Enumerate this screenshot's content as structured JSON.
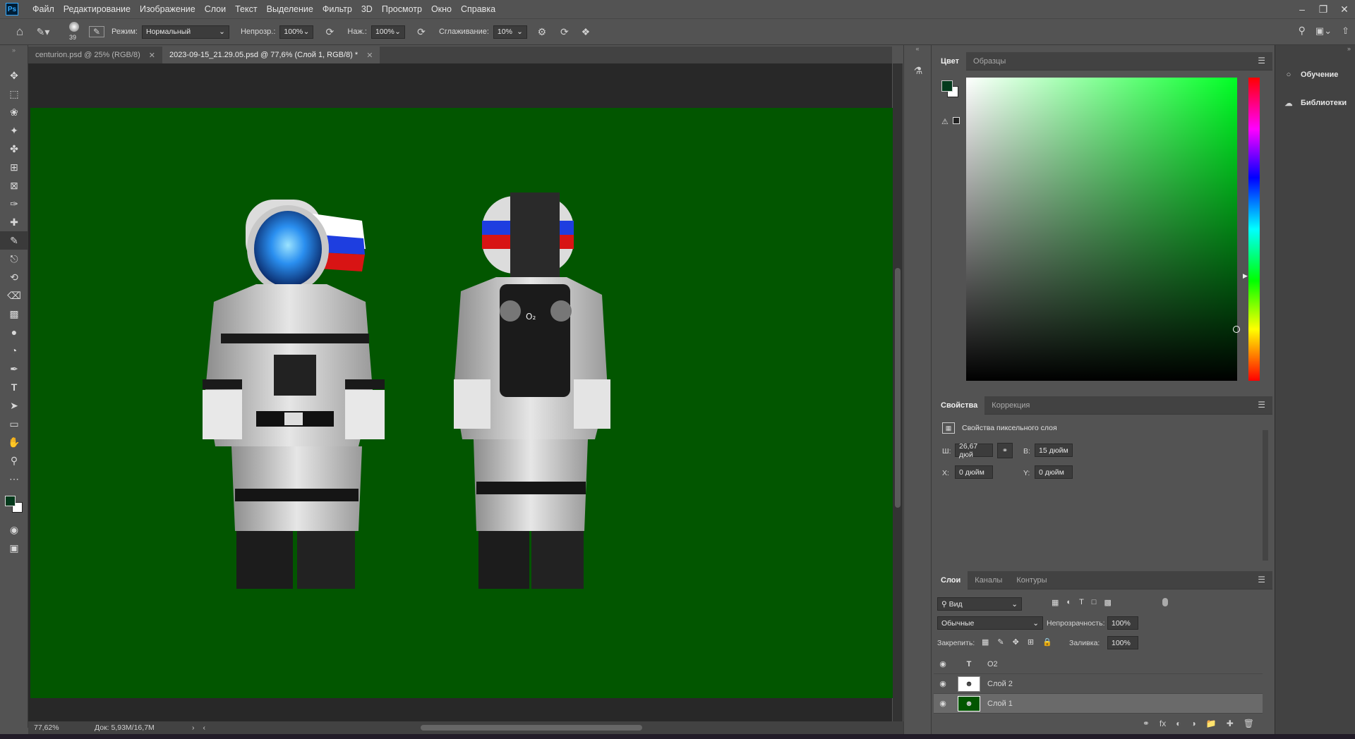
{
  "app": {
    "logo": "Ps"
  },
  "menu": [
    "Файл",
    "Редактирование",
    "Изображение",
    "Слои",
    "Текст",
    "Выделение",
    "Фильтр",
    "3D",
    "Просмотр",
    "Окно",
    "Справка"
  ],
  "options": {
    "brush_size": "39",
    "mode_label": "Режим:",
    "mode_value": "Нормальный",
    "opacity_label": "Непрозр.:",
    "opacity_value": "100%",
    "pressure_label": "Наж.:",
    "pressure_value": "100%",
    "smoothing_label": "Сглаживание:",
    "smoothing_value": "10%"
  },
  "tabs": [
    {
      "label": "centurion.psd @ 25% (RGB/8)",
      "active": false
    },
    {
      "label": "2023-09-15_21.29.05.psd @ 77,6% (Слой 1, RGB/8) *",
      "active": true
    }
  ],
  "canvas": {
    "bg_color": "#025600",
    "o2_label": "O₂"
  },
  "status": {
    "zoom": "77,62%",
    "doc": "Док: 5,93M/16,7M"
  },
  "color_panel": {
    "tabs": [
      "Цвет",
      "Образцы"
    ],
    "foreground": "#033a1c",
    "background": "#ffffff"
  },
  "properties_panel": {
    "tabs": [
      "Свойства",
      "Коррекция"
    ],
    "subtitle": "Свойства пиксельного слоя",
    "w_label": "Ш:",
    "w_value": "26,67 дюй",
    "h_label": "В:",
    "h_value": "15 дюйм",
    "x_label": "X:",
    "x_value": "0 дюйм",
    "y_label": "Y:",
    "y_value": "0 дюйм"
  },
  "layers_panel": {
    "tabs": [
      "Слои",
      "Каналы",
      "Контуры"
    ],
    "filter_value": "Вид",
    "blend_mode": "Обычные",
    "opacity_label": "Непрозрачность:",
    "opacity_value": "100%",
    "lock_label": "Закрепить:",
    "fill_label": "Заливка:",
    "fill_value": "100%",
    "layers": [
      {
        "name": "O2",
        "kind": "text",
        "selected": false
      },
      {
        "name": "Слой 2",
        "kind": "pixel",
        "selected": false
      },
      {
        "name": "Слой 1",
        "kind": "pixel",
        "selected": true
      }
    ]
  },
  "right_strip": {
    "learn": "Обучение",
    "libraries": "Библиотеки"
  }
}
